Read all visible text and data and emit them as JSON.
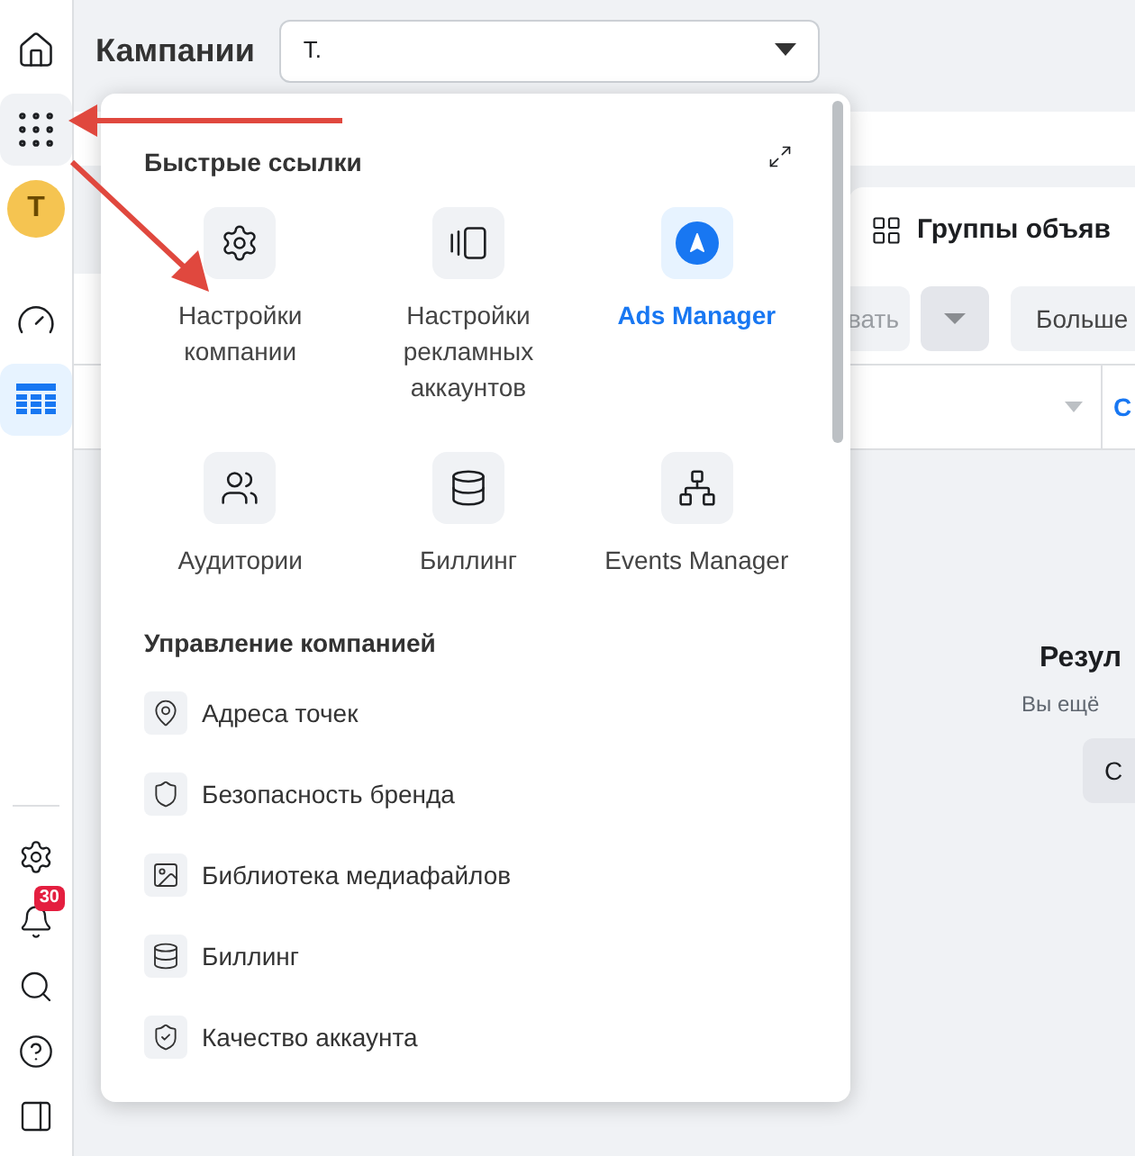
{
  "sidebar": {
    "items": [
      {
        "kind": "home",
        "selected": false
      },
      {
        "kind": "apps",
        "selected": true
      },
      {
        "kind": "avatar",
        "label": "T",
        "selected": false
      },
      {
        "kind": "gauge",
        "selected": false
      },
      {
        "kind": "table",
        "selected": true
      }
    ],
    "bottom_items": [
      {
        "kind": "settings"
      },
      {
        "kind": "bell",
        "badge": "30"
      },
      {
        "kind": "search"
      },
      {
        "kind": "help"
      },
      {
        "kind": "panel"
      }
    ]
  },
  "header": {
    "title": "Кампании",
    "account_select": {
      "value": "T."
    }
  },
  "background": {
    "tab": "Группы объяв",
    "toolbar_buttons": [
      "вать",
      "Больше"
    ],
    "column_3": "С",
    "empty_title": "Резул",
    "empty_text": "Вы ещё",
    "empty_button": "С"
  },
  "popup": {
    "quick_links_title": "Быстрые ссылки",
    "quick_links": [
      {
        "label": "Настройки компании",
        "kind": "settings",
        "active": false
      },
      {
        "label": "Настройки рекламных аккаунтов",
        "kind": "accounts",
        "active": false
      },
      {
        "label": "Ads Manager",
        "kind": "ads",
        "active": true
      },
      {
        "label": "Аудитории",
        "kind": "users",
        "active": false
      },
      {
        "label": "Биллинг",
        "kind": "billing",
        "active": false
      },
      {
        "label": "Events Manager",
        "kind": "events",
        "active": false
      }
    ],
    "section_title": "Управление компанией",
    "items": [
      {
        "label": "Адреса точек",
        "kind": "pin"
      },
      {
        "label": "Безопасность бренда",
        "kind": "shield"
      },
      {
        "label": "Библиотека медиафайлов",
        "kind": "image"
      },
      {
        "label": "Биллинг",
        "kind": "billing"
      },
      {
        "label": "Качество аккаунта",
        "kind": "quality"
      }
    ]
  }
}
